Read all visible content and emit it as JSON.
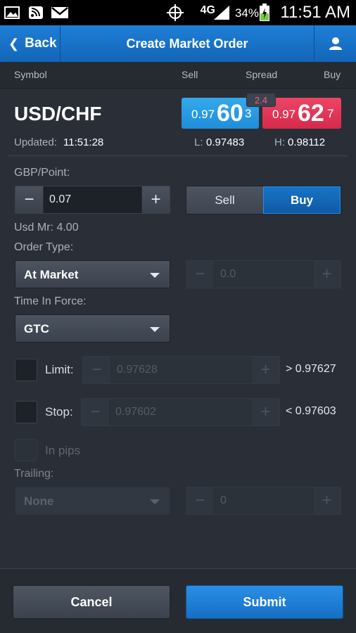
{
  "status_bar": {
    "network": "4G",
    "battery": "34%",
    "time": "11:51 AM"
  },
  "header": {
    "back_label": "Back",
    "title": "Create Market Order",
    "account_icon": "user-icon"
  },
  "columns": {
    "symbol": "Symbol",
    "sell": "Sell",
    "spread": "Spread",
    "buy": "Buy"
  },
  "quote": {
    "symbol": "USD/CHF",
    "spread": "2.4",
    "sell": {
      "prefix": "0.97",
      "big": "60",
      "tail": "3"
    },
    "buy": {
      "prefix": "0.97",
      "big": "62",
      "tail": "7"
    },
    "updated_label": "Updated:",
    "updated_value": "11:51:28",
    "low_label": "L:",
    "low_value": "0.97483",
    "high_label": "H:",
    "high_value": "0.98112",
    "colors": {
      "sell": "#1d8ed8",
      "buy": "#d62a4c"
    }
  },
  "form": {
    "gbp_point_label": "GBP/Point:",
    "gbp_point_value": "0.07",
    "side_sell": "Sell",
    "side_buy": "Buy",
    "selected_side": "Buy",
    "margin": "Usd Mr: 4.00",
    "order_type_label": "Order Type:",
    "order_type_value": "At Market",
    "order_price_value": "0.0",
    "time_in_force_label": "Time In Force:",
    "time_in_force_value": "GTC",
    "limit_label": "Limit:",
    "limit_value": "0.97628",
    "limit_hint": "> 0.97627",
    "stop_label": "Stop:",
    "stop_value": "0.97602",
    "stop_hint": "< 0.97603",
    "in_pips_label": "In pips",
    "trailing_label": "Trailing:",
    "trailing_value": "None",
    "trailing_amount": "0"
  },
  "actions": {
    "cancel": "Cancel",
    "submit": "Submit"
  }
}
